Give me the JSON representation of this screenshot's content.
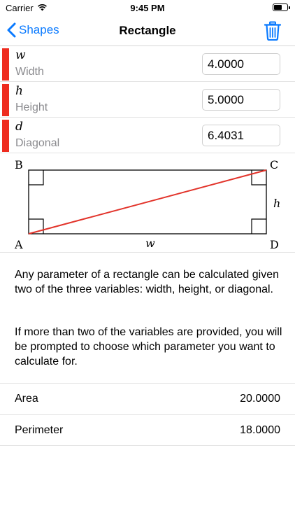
{
  "status_bar": {
    "carrier": "Carrier",
    "time": "9:45 PM",
    "battery_level": 0.6
  },
  "nav": {
    "back_label": "Shapes",
    "title": "Rectangle",
    "back_icon": "chevron-left-icon",
    "trash_icon": "trash-icon",
    "accent_color": "#0a7aff"
  },
  "inputs": [
    {
      "symbol": "w",
      "label": "Width",
      "value": "4.0000"
    },
    {
      "symbol": "h",
      "label": "Height",
      "value": "5.0000"
    },
    {
      "symbol": "d",
      "label": "Diagonal",
      "value": "6.4031"
    }
  ],
  "diagram": {
    "vertices": {
      "A": "A",
      "B": "B",
      "C": "C",
      "D": "D"
    },
    "width_label": "w",
    "height_label": "h",
    "diagonal_color": "#e2332a"
  },
  "description": {
    "paragraph1": "Any parameter of a rectangle can be calculated given two of the three variables: width, height, or diagonal.",
    "paragraph2": "If more than two of the variables are provided, you will be prompted to choose which parameter you want to calculate for."
  },
  "results": [
    {
      "label": "Area",
      "value": "20.0000"
    },
    {
      "label": "Perimeter",
      "value": "18.0000"
    }
  ],
  "marker_color": "#ee2c1f"
}
